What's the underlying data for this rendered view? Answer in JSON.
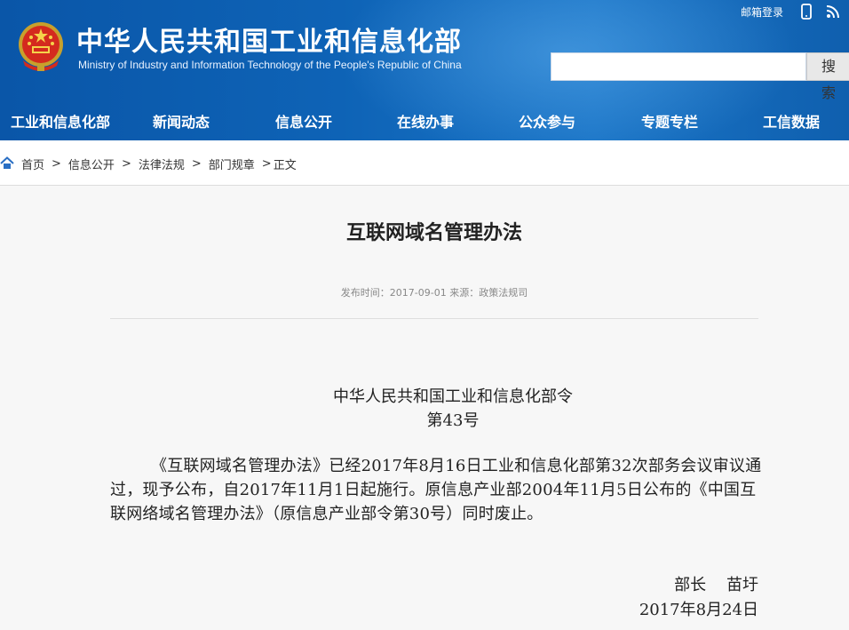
{
  "header": {
    "title": "中华人民共和国工业和信息化部",
    "subtitle": "Ministry of Industry and Information Technology of the People's Republic of China",
    "login_link": "邮箱登录",
    "search_placeholder": "",
    "search_button": "搜索",
    "brand_color": "#0e63b6"
  },
  "nav": {
    "items": [
      {
        "label": "工业和信息化部"
      },
      {
        "label": "新闻动态"
      },
      {
        "label": "信息公开"
      },
      {
        "label": "在线办事"
      },
      {
        "label": "公众参与"
      },
      {
        "label": "专题专栏"
      },
      {
        "label": "工信数据"
      }
    ]
  },
  "breadcrumb": {
    "items": [
      "首页",
      "信息公开",
      "法律法规",
      "部门规章"
    ],
    "separator": ">",
    "current": "正文"
  },
  "article": {
    "title": "互联网域名管理办法",
    "meta": "发布时间：2017-09-01  来源：政策法规司",
    "order_line1": "中华人民共和国工业和信息化部令",
    "order_line2": "第43号",
    "paragraph": "《互联网域名管理办法》已经2017年8月16日工业和信息化部第32次部务会议审议通过，现予公布，自2017年11月1日起施行。原信息产业部2004年11月5日公布的《中国互联网络域名管理办法》（原信息产业部令第30号）同时废止。",
    "signature_title": "部长    苗圩",
    "signature_date": "2017年8月24日"
  }
}
